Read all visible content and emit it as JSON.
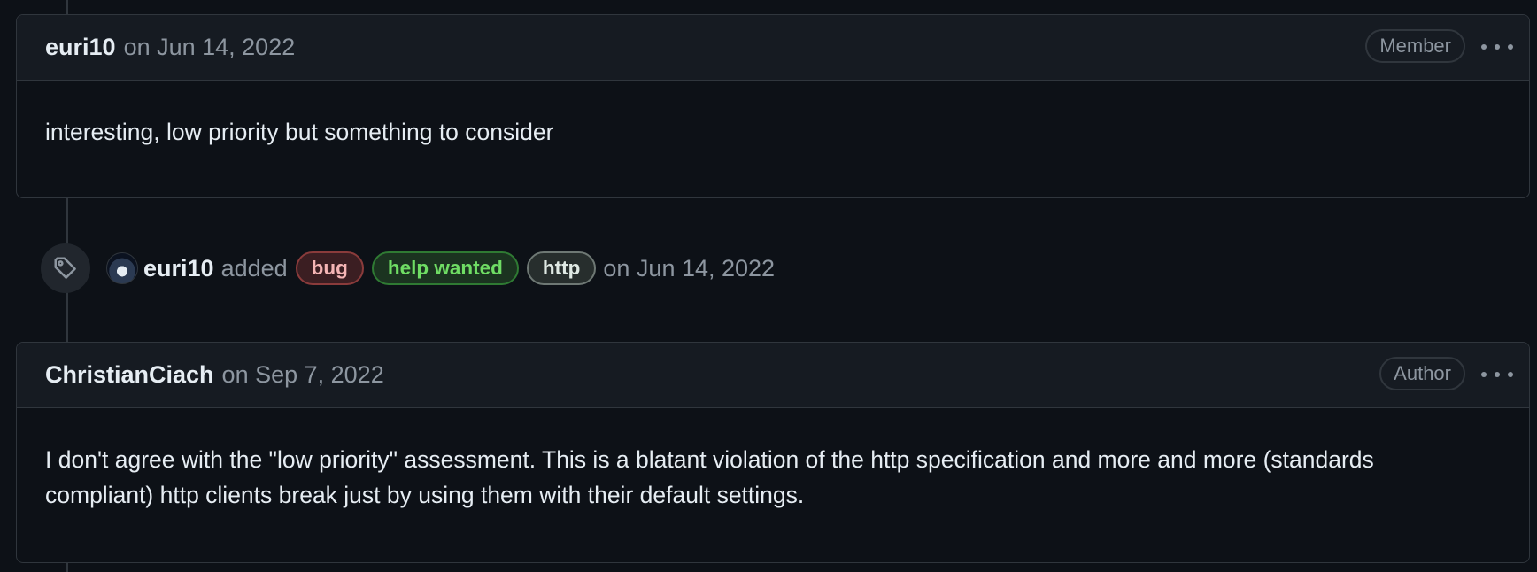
{
  "comments": [
    {
      "author": "euri10",
      "date": "on Jun 14, 2022",
      "role": "Member",
      "body": "interesting, low priority but something to consider"
    },
    {
      "author": "ChristianCiach",
      "date": "on Sep 7, 2022",
      "role": "Author",
      "body": "I don't agree with the \"low priority\" assessment. This is a blatant violation of the http specification and more and more (standards compliant) http clients break just by using them with their default settings."
    }
  ],
  "event": {
    "icon": "tag-icon",
    "author": "euri10",
    "action": "added",
    "labels": [
      {
        "name": "bug",
        "color": "#f5b5b5"
      },
      {
        "name": "help wanted",
        "color": "#6fdd64"
      },
      {
        "name": "http",
        "color": "#dfe9e4"
      }
    ],
    "date": "on Jun 14, 2022"
  },
  "colors": {
    "background": "#0d1117",
    "header_background": "#161b22",
    "border": "#30363d",
    "muted_text": "#8d96a0",
    "primary_text": "#e6edf3"
  }
}
